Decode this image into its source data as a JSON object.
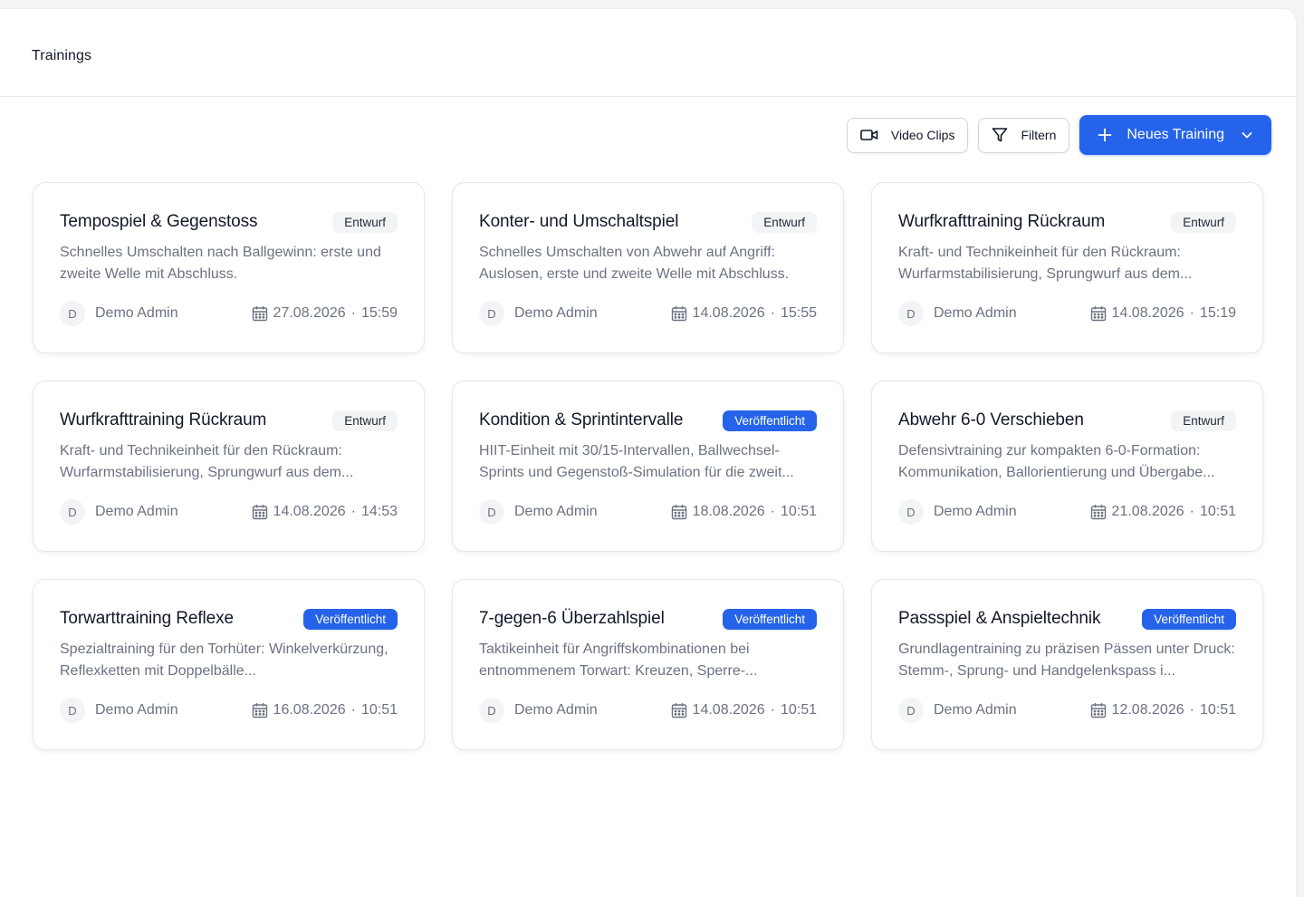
{
  "header": {
    "title": "Trainings"
  },
  "toolbar": {
    "video_clips_label": "Video Clips",
    "filter_label": "Filtern",
    "new_training_label": "Neues Training"
  },
  "colors": {
    "primary": "#2563eb",
    "muted_text": "#6b7280",
    "draft_badge_bg": "#f3f4f6"
  },
  "icons": {
    "video": "video-camera-icon",
    "filter": "funnel-icon",
    "plus": "plus-icon",
    "chevron": "chevron-down-icon",
    "calendar": "calendar-icon"
  },
  "trainings": [
    {
      "title": "Tempospiel & Gegenstoss",
      "status": "Entwurf",
      "status_type": "draft",
      "description": "Schnelles Umschalten nach Ballgewinn: erste und zweite Welle mit Abschluss.",
      "author_initial": "D",
      "author": "Demo Admin",
      "date": "27.08.2026",
      "time": "15:59"
    },
    {
      "title": "Konter- und Umschaltspiel",
      "status": "Entwurf",
      "status_type": "draft",
      "description": "Schnelles Umschalten von Abwehr auf Angriff: Auslosen, erste und zweite Welle mit Abschluss.",
      "author_initial": "D",
      "author": "Demo Admin",
      "date": "14.08.2026",
      "time": "15:55"
    },
    {
      "title": "Wurfkrafttraining Rückraum",
      "status": "Entwurf",
      "status_type": "draft",
      "description": "Kraft- und Technikeinheit für den Rückraum: Wurfarmstabilisierung, Sprungwurf aus dem...",
      "author_initial": "D",
      "author": "Demo Admin",
      "date": "14.08.2026",
      "time": "15:19"
    },
    {
      "title": "Wurfkrafttraining Rückraum",
      "status": "Entwurf",
      "status_type": "draft",
      "description": "Kraft- und Technikeinheit für den Rückraum: Wurfarmstabilisierung, Sprungwurf aus dem...",
      "author_initial": "D",
      "author": "Demo Admin",
      "date": "14.08.2026",
      "time": "14:53"
    },
    {
      "title": "Kondition & Sprintintervalle",
      "status": "Veröffentlicht",
      "status_type": "published",
      "description": "HIIT-Einheit mit 30/15-Intervallen, Ballwechsel-Sprints und Gegenstoß-Simulation für die zweit...",
      "author_initial": "D",
      "author": "Demo Admin",
      "date": "18.08.2026",
      "time": "10:51"
    },
    {
      "title": "Abwehr 6-0 Verschieben",
      "status": "Entwurf",
      "status_type": "draft",
      "description": "Defensivtraining zur kompakten 6-0-Formation: Kommunikation, Ballorientierung und Übergabe...",
      "author_initial": "D",
      "author": "Demo Admin",
      "date": "21.08.2026",
      "time": "10:51"
    },
    {
      "title": "Torwarttraining Reflexe",
      "status": "Veröffentlicht",
      "status_type": "published",
      "description": "Spezialtraining für den Torhüter: Winkelverkürzung, Reflexketten mit Doppelbälle...",
      "author_initial": "D",
      "author": "Demo Admin",
      "date": "16.08.2026",
      "time": "10:51"
    },
    {
      "title": "7-gegen-6 Überzahlspiel",
      "status": "Veröffentlicht",
      "status_type": "published",
      "description": "Taktikeinheit für Angriffskombinationen bei entnommenem Torwart: Kreuzen, Sperre-...",
      "author_initial": "D",
      "author": "Demo Admin",
      "date": "14.08.2026",
      "time": "10:51"
    },
    {
      "title": "Passspiel & Anspieltechnik",
      "status": "Veröffentlicht",
      "status_type": "published",
      "description": "Grundlagentraining zu präzisen Pässen unter Druck: Stemm-, Sprung- und Handgelenkspass i...",
      "author_initial": "D",
      "author": "Demo Admin",
      "date": "12.08.2026",
      "time": "10:51"
    }
  ]
}
